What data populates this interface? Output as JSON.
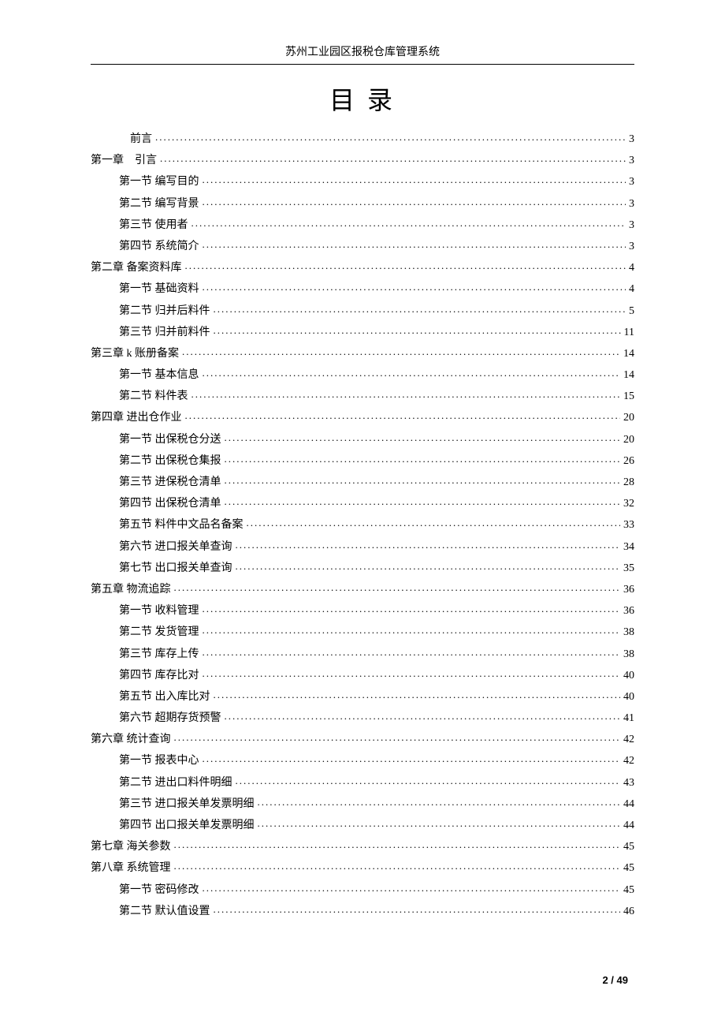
{
  "header": {
    "title": "苏州工业园区报税仓库管理系统"
  },
  "toc_title": "目 录",
  "toc": [
    {
      "level": 0,
      "label": "前言",
      "page": "3"
    },
    {
      "level": 1,
      "label": "第一章　引言",
      "page": "3"
    },
    {
      "level": 2,
      "label": "第一节 编写目的",
      "page": "3"
    },
    {
      "level": 2,
      "label": "第二节 编写背景",
      "page": "3"
    },
    {
      "level": 2,
      "label": "第三节 使用者",
      "page": "3"
    },
    {
      "level": 2,
      "label": "第四节 系统简介",
      "page": "3"
    },
    {
      "level": 1,
      "label": "第二章 备案资料库",
      "page": "4"
    },
    {
      "level": 2,
      "label": "第一节 基础资料",
      "page": "4"
    },
    {
      "level": 2,
      "label": "第二节 归并后料件",
      "page": "5"
    },
    {
      "level": 2,
      "label": "第三节 归并前料件",
      "page": "11"
    },
    {
      "level": 1,
      "label": "第三章 k 账册备案",
      "page": "14"
    },
    {
      "level": 2,
      "label": "第一节 基本信息",
      "page": "14"
    },
    {
      "level": 2,
      "label": "第二节 料件表",
      "page": "15"
    },
    {
      "level": 1,
      "label": "第四章 进出仓作业",
      "page": "20"
    },
    {
      "level": 2,
      "label": "第一节 出保税仓分送",
      "page": "20"
    },
    {
      "level": 2,
      "label": "第二节 出保税仓集报",
      "page": "26"
    },
    {
      "level": 2,
      "label": "第三节 进保税仓清单",
      "page": "28"
    },
    {
      "level": 2,
      "label": "第四节 出保税仓清单",
      "page": "32"
    },
    {
      "level": 2,
      "label": "第五节 料件中文品名备案",
      "page": "33"
    },
    {
      "level": 2,
      "label": "第六节 进口报关单查询",
      "page": "34"
    },
    {
      "level": 2,
      "label": "第七节 出口报关单查询",
      "page": "35"
    },
    {
      "level": 1,
      "label": "第五章 物流追踪",
      "page": "36"
    },
    {
      "level": 2,
      "label": "第一节 收料管理",
      "page": "36"
    },
    {
      "level": 2,
      "label": "第二节 发货管理",
      "page": "38"
    },
    {
      "level": 2,
      "label": "第三节 库存上传",
      "page": "38"
    },
    {
      "level": 2,
      "label": "第四节 库存比对",
      "page": "40"
    },
    {
      "level": 2,
      "label": "第五节 出入库比对",
      "page": "40"
    },
    {
      "level": 2,
      "label": "第六节 超期存货预警",
      "page": "41"
    },
    {
      "level": 1,
      "label": "第六章 统计查询",
      "page": "42"
    },
    {
      "level": 2,
      "label": "第一节 报表中心",
      "page": "42"
    },
    {
      "level": 2,
      "label": "第二节 进出口料件明细",
      "page": "43"
    },
    {
      "level": 2,
      "label": "第三节 进口报关单发票明细",
      "page": "44"
    },
    {
      "level": 2,
      "label": "第四节 出口报关单发票明细",
      "page": "44"
    },
    {
      "level": 1,
      "label": "第七章 海关参数",
      "page": "45"
    },
    {
      "level": 1,
      "label": "第八章 系统管理",
      "page": "45"
    },
    {
      "level": 2,
      "label": "第一节 密码修改",
      "page": "45"
    },
    {
      "level": 2,
      "label": "第二节 默认值设置",
      "page": "46"
    }
  ],
  "footer": {
    "current": "2",
    "separator": " / ",
    "total": "49"
  }
}
